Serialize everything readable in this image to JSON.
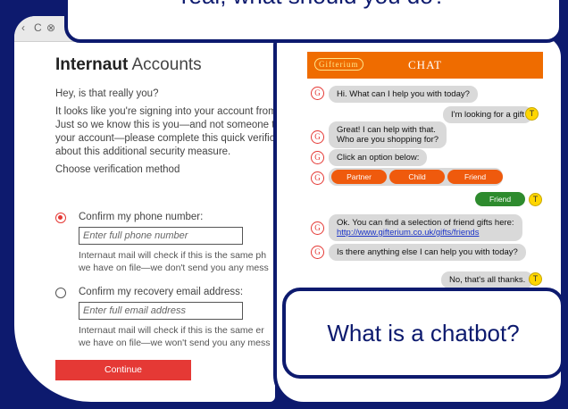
{
  "banner": {
    "text": "real, what should you do?"
  },
  "browser": {
    "nav_back": "‹",
    "nav_reload": "C",
    "nav_stop": "⊗"
  },
  "login": {
    "brand_bold": "Internaut",
    "brand_light": " Accounts",
    "greeting": "Hey, is that really you?",
    "explanation": [
      "It looks like you're signing into your account from a",
      "Just so we know this is you—and not someone try",
      "your account—please complete this quick verificat",
      "about this additional security measure."
    ],
    "choose_label": "Choose verification method",
    "phone": {
      "label": "Confirm my phone number:",
      "placeholder": "Enter full phone number",
      "note": [
        "Internaut mail will check if this is the same ph",
        "we have on file—we don't send you any mess"
      ]
    },
    "email": {
      "label": "Confirm my recovery email address:",
      "placeholder": "Enter full email address",
      "note": [
        "Internaut mail will check if this is the same er",
        "we have on file—we won't send you any mess"
      ]
    },
    "continue_label": "Continue"
  },
  "chat": {
    "logo": "Gifterium",
    "title": "CHAT",
    "avatar_bot": "G",
    "avatar_user": "T",
    "messages": {
      "m1": "Hi. What can I help you with today?",
      "m2": "I'm looking for a gift",
      "m3a": "Great!  I can help with that.",
      "m3b": "Who are you shopping for?",
      "m4": "Click an option below:",
      "m5a": "Ok.  You can find a selection of friend gifts here:",
      "m5b": "http://www.gifterium.co.uk/gifts/friends",
      "m6": "Is there anything else I can help you with today?",
      "m7": "No, that's all thanks."
    },
    "options": [
      "Partner",
      "Child",
      "Friend"
    ],
    "user_pick": "Friend"
  },
  "definition": {
    "text": "What is a chatbot?"
  },
  "colors": {
    "navy": "#0d1a6e",
    "accent_red": "#e53935",
    "chat_orange": "#ef6c00",
    "option_orange": "#ef5a0d",
    "pick_green": "#2e8b2e",
    "avatar_yellow": "#ffd600"
  }
}
